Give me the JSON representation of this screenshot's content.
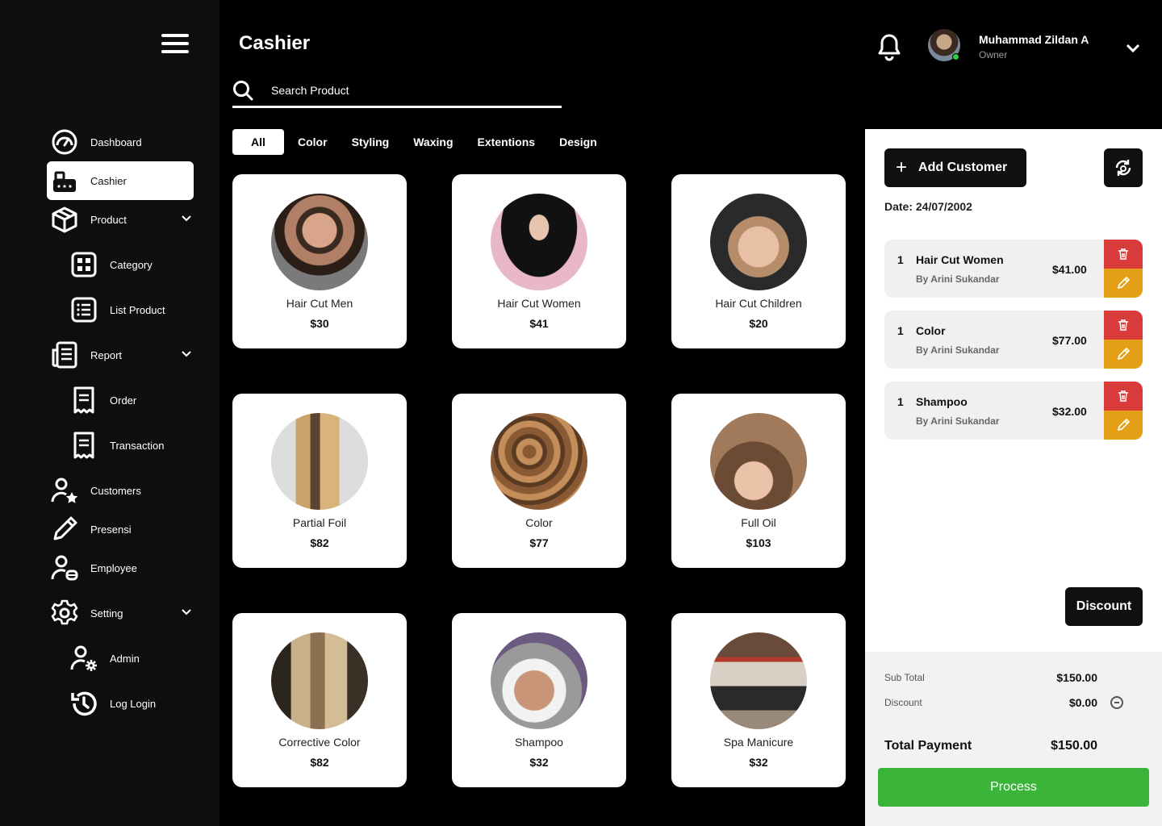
{
  "sidebar": {
    "items": [
      {
        "label": "Dashboard",
        "icon": "dashboard-gauge-icon"
      },
      {
        "label": "Cashier",
        "icon": "cash-register-icon",
        "active": true
      },
      {
        "label": "Product",
        "icon": "box-icon"
      },
      {
        "label": "Category",
        "icon": "grid-icon"
      },
      {
        "label": "List Product",
        "icon": "list-icon"
      },
      {
        "label": "Report",
        "icon": "report-icon"
      },
      {
        "label": "Order",
        "icon": "receipt-icon"
      },
      {
        "label": "Transaction",
        "icon": "receipt-icon"
      },
      {
        "label": "Customers",
        "icon": "user-star-icon"
      },
      {
        "label": "Presensi",
        "icon": "pencil-icon"
      },
      {
        "label": "Employee",
        "icon": "user-badge-icon"
      },
      {
        "label": "Setting",
        "icon": "gear-icon"
      },
      {
        "label": "Admin",
        "icon": "user-gear-icon"
      },
      {
        "label": "Log Login",
        "icon": "history-icon"
      }
    ]
  },
  "header": {
    "title": "Cashier",
    "search_placeholder": "Search Product",
    "user_name": "Muhammad Zildan A",
    "user_role": "Owner"
  },
  "tabs": [
    "All",
    "Color",
    "Styling",
    "Waxing",
    "Extentions",
    "Design"
  ],
  "products": [
    {
      "name": "Hair Cut Men",
      "price": "$30",
      "photo": "man-haircut-photo"
    },
    {
      "name": "Hair Cut Women",
      "price": "$41",
      "photo": "woman-long-hair-photo"
    },
    {
      "name": "Hair Cut Children",
      "price": "$20",
      "photo": "boy-haircut-photo"
    },
    {
      "name": "Partial Foil",
      "price": "$82",
      "photo": "wavy-blonde-hair-photo"
    },
    {
      "name": "Color",
      "price": "$77",
      "photo": "brown-curls-photo"
    },
    {
      "name": "Full Oil",
      "price": "$103",
      "photo": "hair-oil-photo"
    },
    {
      "name": "Corrective Color",
      "price": "$82",
      "photo": "blonde-straight-hair-photo"
    },
    {
      "name": "Shampoo",
      "price": "$32",
      "photo": "hair-wash-photo"
    },
    {
      "name": "Spa Manicure",
      "price": "$32",
      "photo": "salon-interior-photo"
    }
  ],
  "panel": {
    "add_customer": "Add Customer",
    "date": "Date: 24/07/2002",
    "orders": [
      {
        "qty": "1",
        "name": "Hair Cut Women",
        "by": "By Arini Sukandar",
        "price": "$41.00"
      },
      {
        "qty": "1",
        "name": "Color",
        "by": "By Arini Sukandar",
        "price": "$77.00"
      },
      {
        "qty": "1",
        "name": "Shampoo",
        "by": "By Arini Sukandar",
        "price": "$32.00"
      }
    ],
    "discount_button": "Discount",
    "subtotal_label": "Sub Total",
    "subtotal": "$150.00",
    "discount_label": "Discount",
    "discount": "$0.00",
    "total_label": "Total Payment",
    "total": "$150.00",
    "process": "Process"
  },
  "colors": {
    "background": "#000000",
    "sidebar": "#0e0e10",
    "delete": "#d93a3a",
    "edit": "#e3a016",
    "process": "#3ab53a",
    "online": "#2ecc40"
  }
}
